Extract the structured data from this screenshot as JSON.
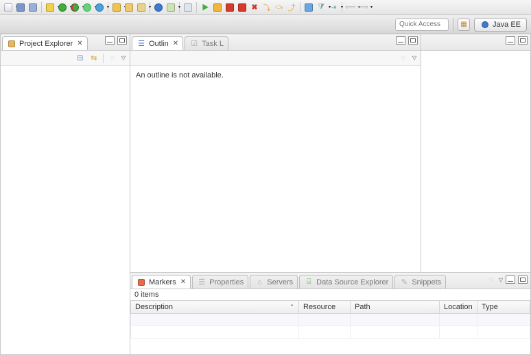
{
  "toolbar": {
    "icons": [
      "new-file",
      "save",
      "save-all",
      "",
      "star",
      "run",
      "run-ext",
      "debug",
      "",
      "sync",
      "",
      "new-project",
      "open",
      "wand",
      "",
      "globe",
      "java-editor",
      "",
      "window",
      "",
      "resume",
      "pause",
      "stop",
      "disconnect",
      "red-x",
      "step-into",
      "step-over",
      "step-return",
      "",
      "tasks",
      "filter",
      "collapse",
      "",
      "back",
      "forward"
    ]
  },
  "topstrip": {
    "quick_access_placeholder": "Quick Access",
    "perspective_label": "Java EE"
  },
  "left": {
    "tab_label": "Project Explorer",
    "toolbar_icons": [
      "collapse-all-icon",
      "link-editor-icon",
      "view-menu-icon"
    ]
  },
  "editor": {},
  "right": {
    "tabs": [
      {
        "label": "Outlin",
        "active": true
      },
      {
        "label": "Task L",
        "active": false
      }
    ],
    "body_text": "An outline is not available."
  },
  "bottom": {
    "tabs": [
      {
        "label": "Markers",
        "active": true
      },
      {
        "label": "Properties",
        "active": false
      },
      {
        "label": "Servers",
        "active": false
      },
      {
        "label": "Data Source Explorer",
        "active": false
      },
      {
        "label": "Snippets",
        "active": false
      }
    ],
    "items_text": "0 items",
    "columns": [
      "Description",
      "Resource",
      "Path",
      "Location",
      "Type"
    ]
  }
}
